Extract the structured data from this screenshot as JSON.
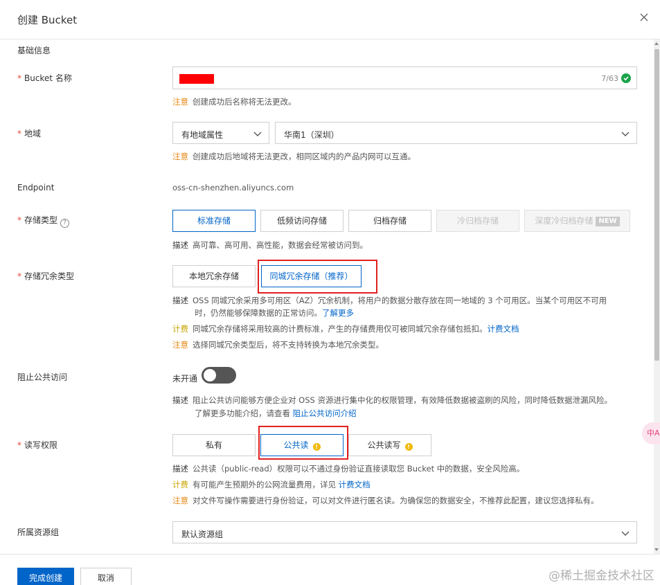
{
  "dialog": {
    "title": "创建 Bucket",
    "close_icon": "close-icon"
  },
  "basic_info": {
    "title": "基础信息"
  },
  "bucket_name": {
    "label": "Bucket 名称",
    "required_mark": "*",
    "counter": "7/63",
    "valid_icon": "check-circle-icon",
    "note_tag": "注意",
    "note_text": "创建成功后名称将无法更改。"
  },
  "region": {
    "label": "地域",
    "required_mark": "*",
    "attribute_select": "有地域属性",
    "region_select": "华南1（深圳）",
    "note_tag": "注意",
    "note_text": "创建成功后地域将无法更改，相同区域内的产品内网可以互通。"
  },
  "endpoint": {
    "label": "Endpoint",
    "value": "oss-cn-shenzhen.aliyuncs.com"
  },
  "storage_class": {
    "label": "存储类型",
    "required_mark": "*",
    "help_icon": "question-circle-icon",
    "help_glyph": "?",
    "options": [
      "标准存储",
      "低频访问存储",
      "归档存储",
      "冷归档存储",
      "深度冷归档存储"
    ],
    "selected": "标准存储",
    "new_badge": "NEW",
    "desc_tag": "描述",
    "desc_text": "高可靠、高可用、高性能，数据会经常被访问到。"
  },
  "redundancy": {
    "label": "存储冗余类型",
    "required_mark": "*",
    "options": [
      "本地冗余存储",
      "同城冗余存储（推荐）"
    ],
    "selected": "同城冗余存储（推荐）",
    "desc_tag": "描述",
    "desc_line1": "OSS 同城冗余采用多可用区（AZ）冗余机制，将用户的数据分散存放在同一地域的 3 个可用区。当某个可用区不可用",
    "desc_line2": "时，仍然能够保障数据的正常访问。",
    "desc_link": "了解更多",
    "bill_tag": "计费",
    "bill_text": "同城冗余存储将采用较高的计费标准，产生的存储费用仅可被同城冗余存储包抵扣。",
    "bill_link": "计费文档",
    "note_tag": "注意",
    "note_text": "选择同城冗余类型后，将不支持转换为本地冗余类型。"
  },
  "block_public": {
    "label": "阻止公共访问",
    "toggle_label": "未开通",
    "toggle_on": false,
    "desc_tag": "描述",
    "desc_line1": "阻止公共访问能够方便企业对 OSS 资源进行集中化的权限管理，有效降低数据被盗刷的风险，同时降低数据泄漏风险。",
    "desc_line2": "了解更多功能介绍，请查看",
    "desc_link": "阻止公共访问介绍"
  },
  "acl": {
    "label": "读写权限",
    "required_mark": "*",
    "options": [
      "私有",
      "公共读",
      "公共读写"
    ],
    "selected": "公共读",
    "warn_glyph": "!",
    "desc_tag": "描述",
    "desc_text": "公共读（public-read）权限可以不通过身份验证直接读取您 Bucket 中的数据，安全风险高。",
    "bill_tag": "计费",
    "bill_text": "有可能产生预期外的公网流量费用，详见",
    "bill_link": "计费文档",
    "note_tag": "注意",
    "note_text": "对文件写操作需要进行身份验证，可以对文件进行匿名读。为确保您的数据安全，不推荐此配置，建议您选择私有。"
  },
  "resource_group": {
    "label": "所属资源组",
    "value": "默认资源组"
  },
  "footer": {
    "create_button": "完成创建",
    "cancel_button": "取消",
    "watermark": "@稀土掘金技术社区"
  },
  "floating_widget": {
    "text": "中A"
  },
  "colors": {
    "primary": "#0064c8",
    "warn": "#e58a17",
    "highlight_box": "#e02020",
    "required": "#e5453b",
    "success": "#1aa34a"
  }
}
